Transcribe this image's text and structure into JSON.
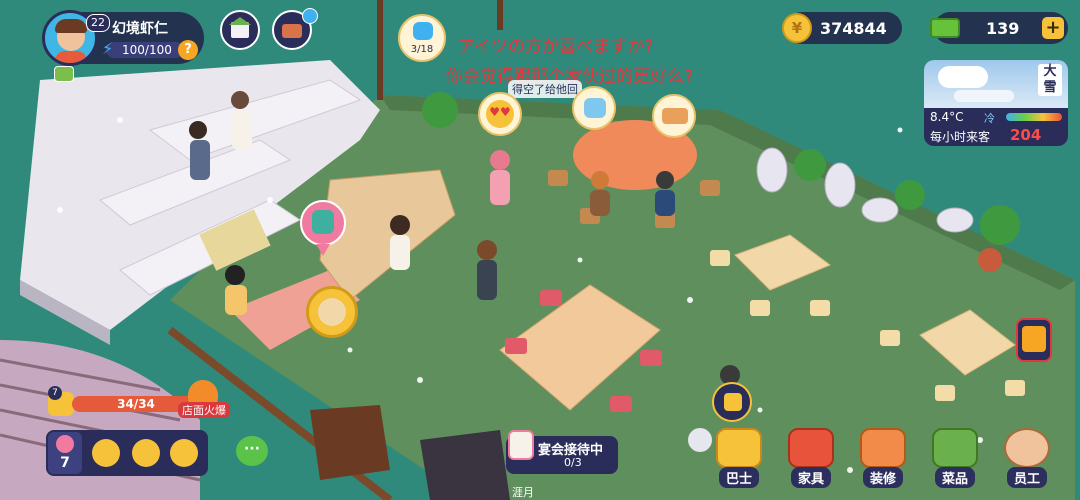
{
  "player": {
    "level": "22",
    "name": "幻境虾仁",
    "energy": "100/100"
  },
  "currency": {
    "coins": "374844",
    "cash": "139"
  },
  "weather": {
    "label": "大雪",
    "temperature": "8.4°C",
    "status": "冷",
    "customers_label": "每小时来客",
    "customers_per_hour": "204"
  },
  "overlay_text": {
    "line1": "アイツの方が喜べますか?",
    "line2": "你会觉得跟那个家伙过的更好么?"
  },
  "speech_bubbles": {
    "seat_progress": "3/18",
    "npc_line": "得空了给他回"
  },
  "fire_meter": {
    "level": "7",
    "value": "34/34",
    "label": "店面火爆"
  },
  "event": {
    "level": "7"
  },
  "banquet": {
    "label": "宴会接待中",
    "progress": "0/3"
  },
  "chair_label": "涯月",
  "bottom_menu": [
    {
      "icon": "bus-icon",
      "label": "巴士"
    },
    {
      "icon": "sofa-icon",
      "label": "家具"
    },
    {
      "icon": "paint-icon",
      "label": "装修"
    },
    {
      "icon": "recipe-book-icon",
      "label": "菜品"
    },
    {
      "icon": "staff-icon",
      "label": "员工"
    }
  ],
  "colors": {
    "floor": "#5e8f5e",
    "hud_bg": "#222648",
    "coin": "#f6c23a",
    "cash": "#66c23a",
    "red_text": "#e0383c",
    "fire_bar": "#e65a3c"
  }
}
